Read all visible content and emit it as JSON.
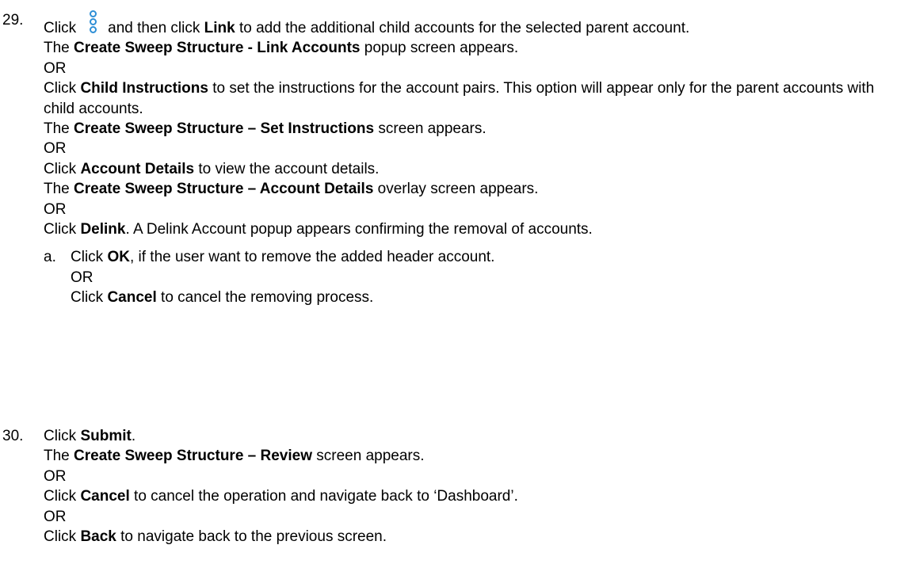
{
  "step29": {
    "number": "29.",
    "intro": {
      "pre": "Click",
      "icon": "kebab-menu-icon",
      "mid": "and then click",
      "link": "Link",
      "post": "to add the additional child accounts for the selected parent account."
    },
    "r1": {
      "pre": "The",
      "bold": "Create Sweep Structure - Link Accounts",
      "post": "popup screen appears."
    },
    "or1": "OR",
    "c2": {
      "pre": "Click",
      "bold": "Child Instructions",
      "post": "to set the instructions for the account pairs. This option will appear only for the parent accounts with child accounts."
    },
    "r2": {
      "pre": "The",
      "bold": "Create Sweep Structure – Set Instructions",
      "post": "screen appears."
    },
    "or2": "OR",
    "c3": {
      "pre": "Click",
      "bold": "Account Details",
      "post": "to view the account details."
    },
    "r3": {
      "pre": "The",
      "bold": "Create Sweep Structure – Account Details",
      "post": "overlay screen appears."
    },
    "or3": "OR",
    "c4": {
      "pre": "Click",
      "bold": "Delink",
      "post": ". A Delink Account popup appears confirming the removal of accounts."
    },
    "sub": {
      "letter": "a.",
      "c1": {
        "pre": "Click",
        "bold": "OK",
        "post": ", if the user want to remove the added header account."
      },
      "or": "OR",
      "c2": {
        "pre": "Click",
        "bold": "Cancel",
        "post": "to cancel the removing process."
      }
    }
  },
  "step30": {
    "number": "30.",
    "c1": {
      "pre": "Click",
      "bold": "Submit",
      "post": "."
    },
    "r1": {
      "pre": "The",
      "bold": "Create Sweep Structure – Review",
      "post": "screen appears."
    },
    "or1": "OR",
    "c2": {
      "pre": "Click",
      "bold": "Cancel",
      "post": "to cancel the operation and navigate back to ‘Dashboard’."
    },
    "or2": "OR",
    "c3": {
      "pre": "Click",
      "bold": "Back",
      "post": "to navigate back to the previous screen."
    }
  },
  "colors": {
    "text": "#000000",
    "icon": "#2e8fd6",
    "background": "#ffffff"
  }
}
